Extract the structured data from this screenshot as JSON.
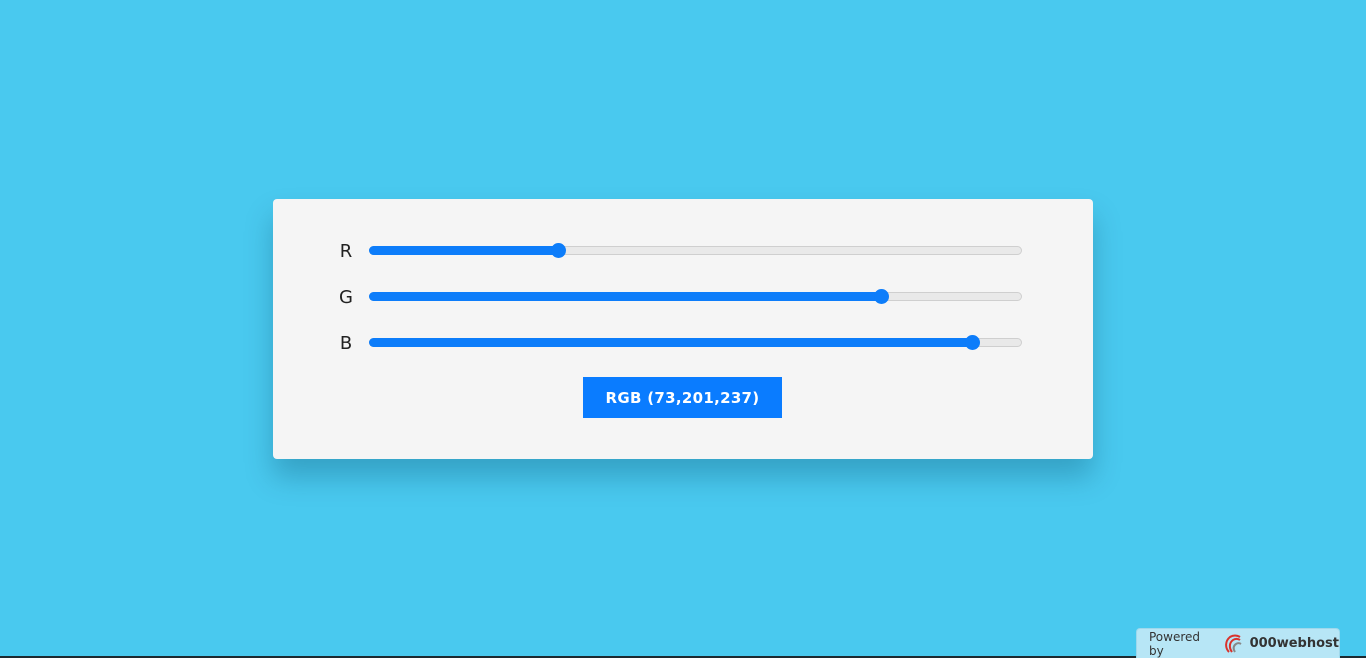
{
  "colors": {
    "background": "#49c9ef",
    "card": "#f5f5f5",
    "accent": "#0a7cff"
  },
  "sliders": [
    {
      "label": "R",
      "value": 73,
      "max": 255
    },
    {
      "label": "G",
      "value": 201,
      "max": 255
    },
    {
      "label": "B",
      "value": 237,
      "max": 255
    }
  ],
  "rgb_button": {
    "label": "RGB (73,201,237)"
  },
  "footer": {
    "powered_label": "Powered by",
    "host_name": "000webhost",
    "host_icon": "000webhost-logo-icon"
  }
}
